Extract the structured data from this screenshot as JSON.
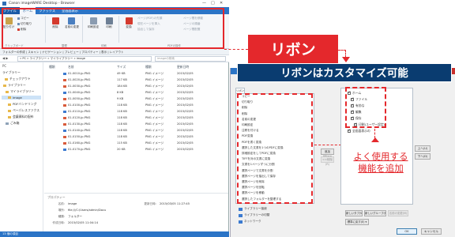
{
  "window": {
    "title": "Canon imageWARE Desktop - Browser",
    "tabs": [
      "ファイル",
      "ホーム",
      "ファックス",
      "全画面表示"
    ],
    "ctrl_min": "—",
    "ctrl_max": "□",
    "ctrl_close": "✕"
  },
  "ribbon": {
    "home": {
      "paste": "貼り付け",
      "copy": "コピー",
      "cut": "切り取り",
      "delete_sm": "削除",
      "group_clipboard": "クリップボード"
    },
    "organize": {
      "delete": "削除",
      "rename": "名前の変更",
      "group": "整理"
    },
    "print": {
      "print_settings": "印刷設定",
      "print": "印刷",
      "group": "印刷"
    },
    "doc": {
      "convert": "変換",
      "r1": "ページ(PDF)の先頭",
      "r2": "現在ページを挿入",
      "r3": "抽出して保存",
      "r4": "ページ間を移動",
      "r5": "ページの順番",
      "r6": "ページ間配置",
      "group": "PDFの操作"
    }
  },
  "qat": {
    "text": "フォルダーの作成 | スキャン | ナビゲーション | プレビュー | プロパティー | 表示 | レイアウト"
  },
  "address": {
    "path": "« PC » ライブラリー » マイライブラリー » image",
    "search": "imageの検索"
  },
  "nav": {
    "top": "PC",
    "items": [
      "ライブラリー",
      "チェックアウト",
      "ライブラリー",
      "マイライブラリー",
      "image",
      "PDFバンドリング",
      "ペーパレスファクス",
      "会議資料の配布",
      "ごみ箱"
    ]
  },
  "list": {
    "headers": {
      "type": "種類",
      "name": "名前",
      "size": "サイズ",
      "kind": "種類",
      "date": "更新日時"
    },
    "rows": [
      {
        "name": "01-0010-jp.PNG",
        "size": "49 KB",
        "kind": "PNG イメージ",
        "date": "2015/02/05"
      },
      {
        "name": "01-0020-jp.PNG",
        "size": "117 KB",
        "kind": "PNG イメージ",
        "date": "2015/02/05"
      },
      {
        "name": "01-0030-jp.PNG",
        "size": "184 KB",
        "kind": "PNG イメージ",
        "date": "2015/02/05"
      },
      {
        "name": "01-0040-jp.PNG",
        "size": "8 KB",
        "kind": "PNG イメージ",
        "date": "2015/02/05"
      },
      {
        "name": "01-0050-jp.PNG",
        "size": "9 KB",
        "kind": "PNG イメージ",
        "date": "2015/02/05"
      },
      {
        "name": "01-0100-jp.PNG",
        "size": "118 KB",
        "kind": "PNG イメージ",
        "date": "2015/02/05"
      },
      {
        "name": "01-0110-jp.PNG",
        "size": "118 KB",
        "kind": "PNG イメージ",
        "date": "2015/02/05"
      },
      {
        "name": "01-0120-jp.PNG",
        "size": "118 KB",
        "kind": "PNG イメージ",
        "date": "2015/02/05"
      },
      {
        "name": "01-0130-jp.PNG",
        "size": "118 KB",
        "kind": "PNG イメージ",
        "date": "2015/02/05"
      },
      {
        "name": "01-0140-jp.PNG",
        "size": "118 KB",
        "kind": "PNG イメージ",
        "date": "2015/02/05"
      },
      {
        "name": "01-0150-jp.PNG",
        "size": "118 KB",
        "kind": "PNG イメージ",
        "date": "2015/02/05"
      },
      {
        "name": "01-0160-jp.PNG",
        "size": "115 KB",
        "kind": "PNG イメージ",
        "date": "2015/02/05"
      },
      {
        "name": "01-0170-jp.PNG",
        "size": "20 KB",
        "kind": "PNG イメージ",
        "date": "2015/02/05"
      }
    ]
  },
  "props": {
    "header": "プロパティー",
    "name_label": "名前:",
    "name": "image",
    "updated_label": "更新日時:",
    "updated": "2015/03/05 11:27:45",
    "loc_label": "場所:",
    "loc": "file:///C:/Users/admin/Docu",
    "kind_label": "種類:",
    "kind": "フォルダー",
    "created_label": "作成日時:",
    "created": "2015/02/05 11:04:14"
  },
  "status": {
    "text": "13 個の項目"
  },
  "callouts": {
    "ribbon": "リボン",
    "customizable": "リボンはカスタマイズ可能",
    "add_line1": "よく使用する",
    "add_line2": "機能を追加"
  },
  "dialog": {
    "left_dropdown": "リボンの変更",
    "commands": [
      "コピー",
      "切り取り",
      "削除",
      "削除",
      "名前の変更",
      "印刷設定",
      "注釈を付ける",
      "PDF変換",
      "PDFを書く変換",
      "選択した文書を1つのPDFに変換",
      "詳細設定をしてPDFに変換",
      "TIFFを対の文書に変換",
      "文書を1ページずつに分割",
      "選択ページで文書を分割",
      "選択ページを抽出して保存",
      "選択ページを削除",
      "選択ページを回転",
      "選択ページを移動",
      "選択したフォルダーを整理する"
    ],
    "below": [
      "ライブラリー接続",
      "ライブラリーの切替",
      "ネットワーク"
    ],
    "add_button": "追加(A)>>",
    "remove_button": "<<削除(R)",
    "tree": {
      "root": "ホーム",
      "items": [
        "ファイル",
        "有効な",
        "編集",
        "保存",
        "印刷(ユーザー設定)",
        "全画面表示の"
      ]
    },
    "up_button": "上へ(U)",
    "down_button": "下へ(D)",
    "new_tab": "新しいタブ(W)",
    "new_group": "新しいグループ(N)",
    "rename": "名前の変更(M)",
    "reset": "標準に戻す(E) ▾",
    "ok": "OK",
    "cancel": "キャンセル"
  }
}
